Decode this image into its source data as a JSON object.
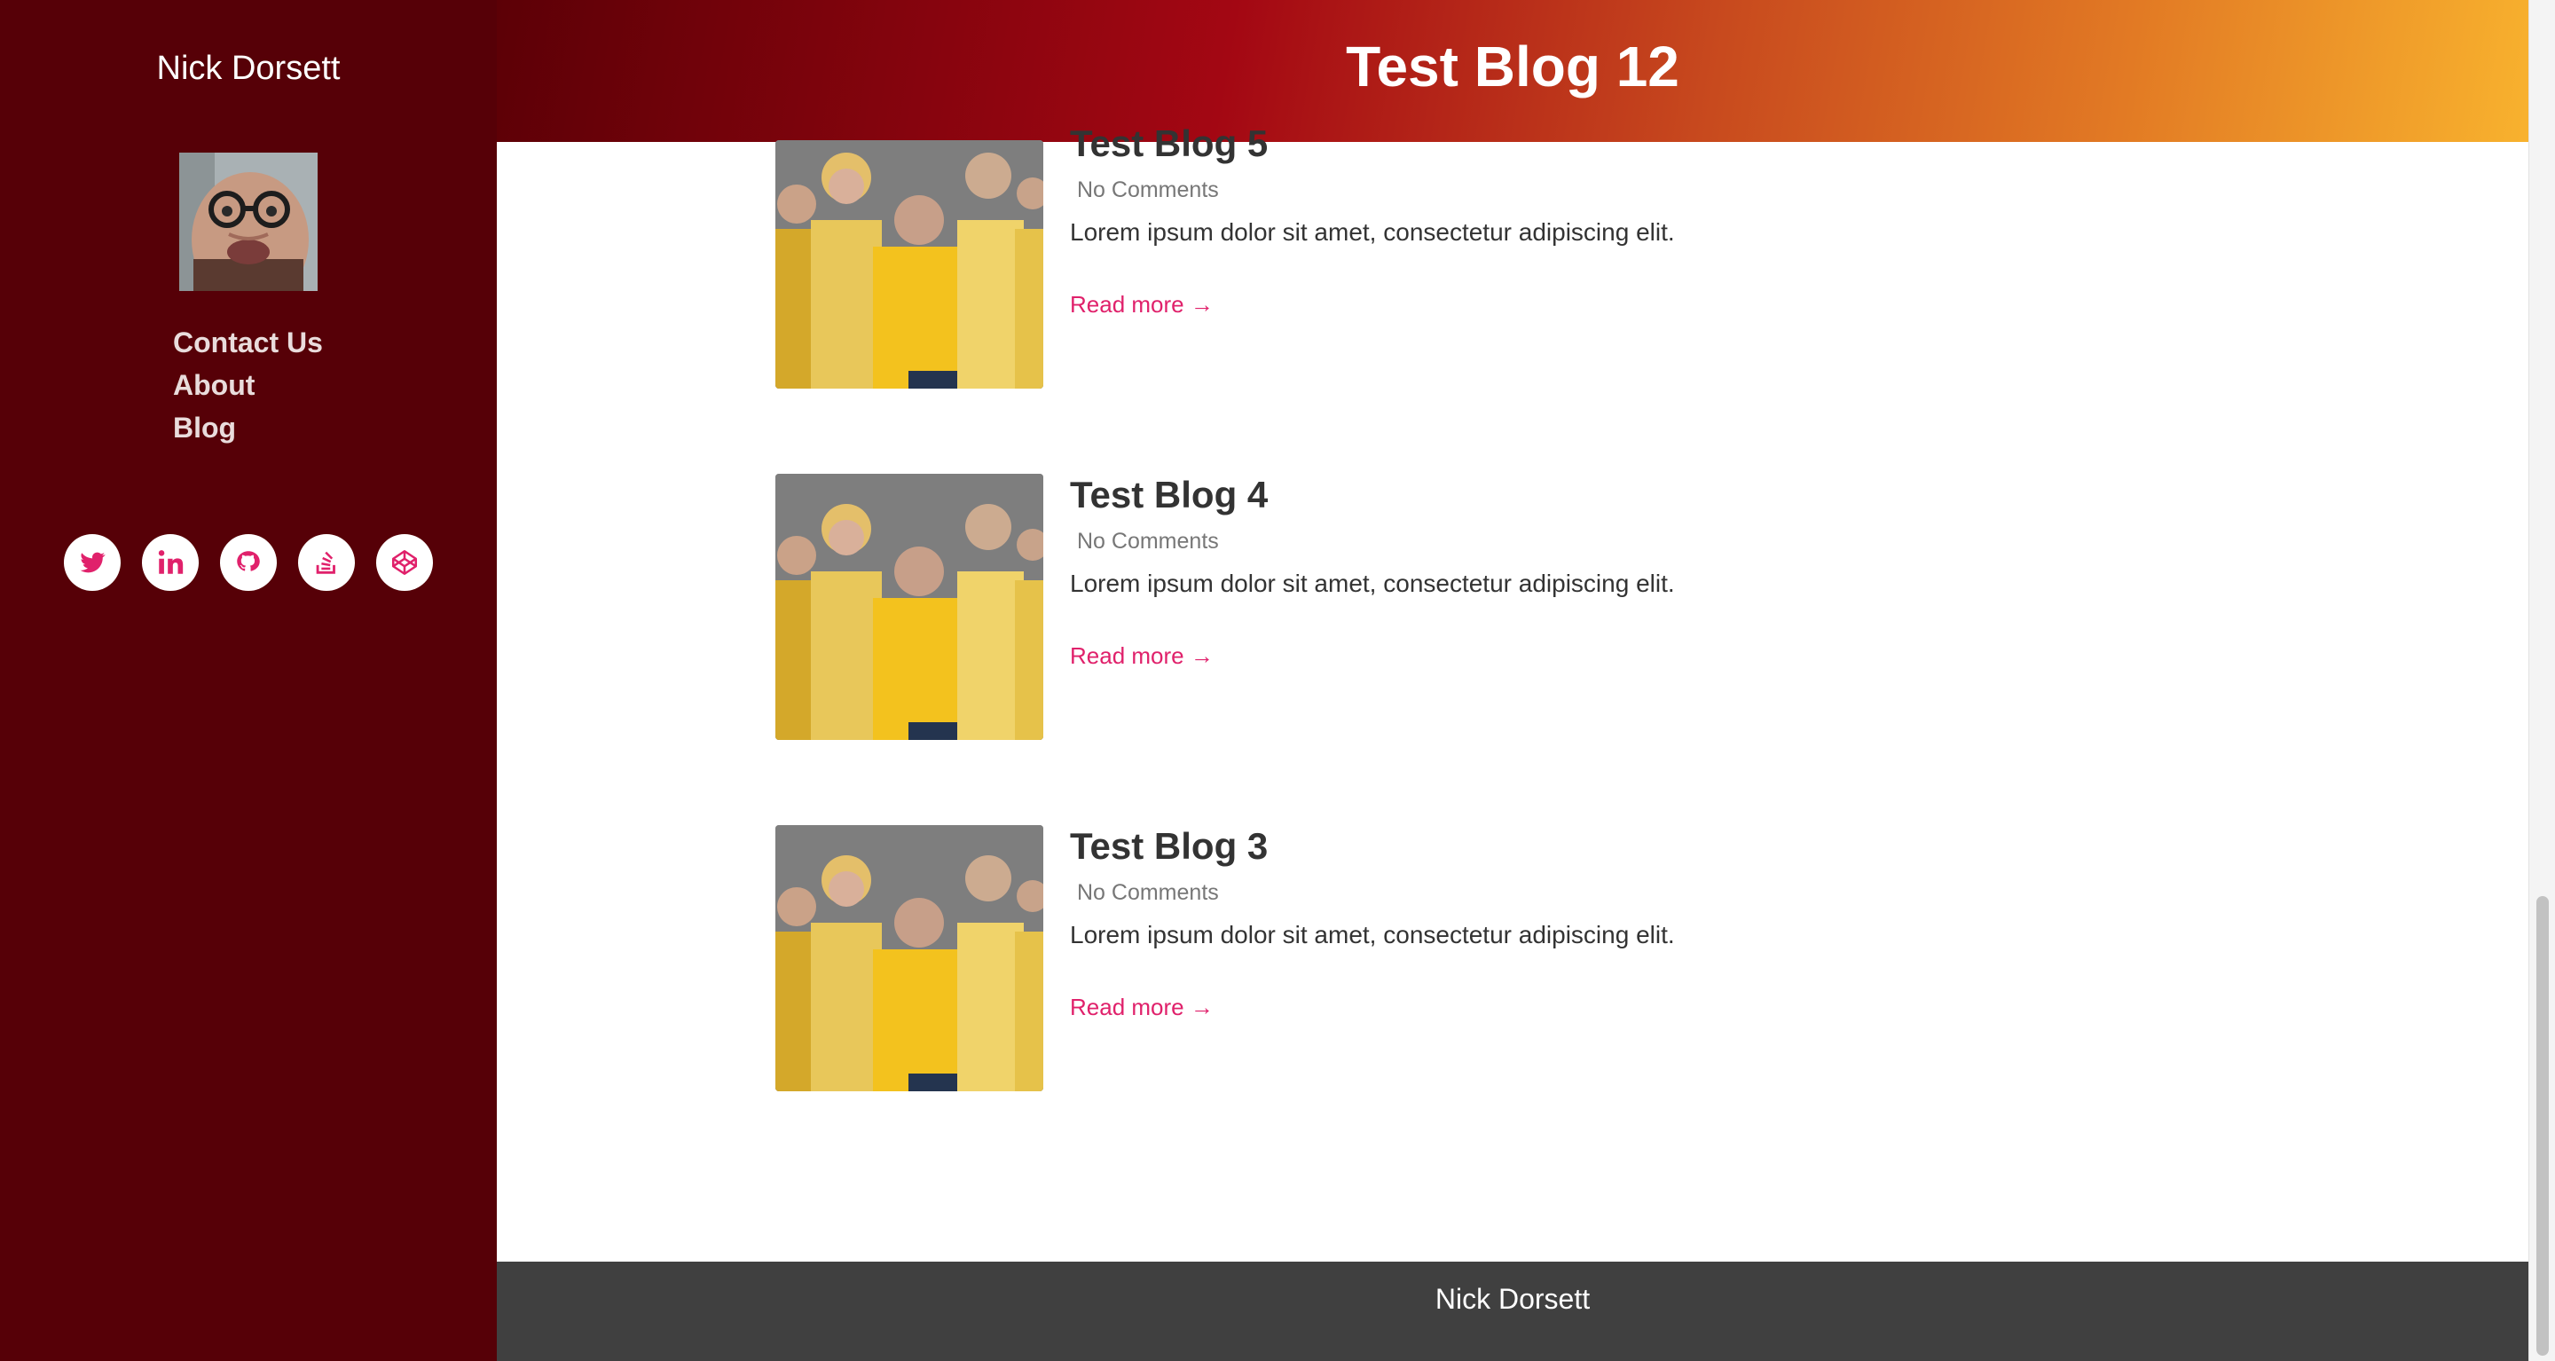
{
  "sidebar": {
    "name": "Nick Dorsett",
    "nav": [
      {
        "label": "Contact Us"
      },
      {
        "label": "About"
      },
      {
        "label": "Blog"
      }
    ],
    "socials": [
      {
        "icon": "twitter-icon"
      },
      {
        "icon": "linkedin-icon"
      },
      {
        "icon": "github-icon"
      },
      {
        "icon": "stackoverflow-icon"
      },
      {
        "icon": "codepen-icon"
      }
    ]
  },
  "header": {
    "title": "Test Blog 12"
  },
  "posts": [
    {
      "title": "Test Blog 5",
      "comments": "No Comments",
      "excerpt": "Lorem ipsum dolor sit amet, consectetur adipiscing elit.",
      "read_more": "Read more →"
    },
    {
      "title": "Test Blog 4",
      "comments": "No Comments",
      "excerpt": "Lorem ipsum dolor sit amet, consectetur adipiscing elit.",
      "read_more": "Read more →"
    },
    {
      "title": "Test Blog 3",
      "comments": "No Comments",
      "excerpt": "Lorem ipsum dolor sit amet, consectetur adipiscing elit.",
      "read_more": "Read more →"
    }
  ],
  "footer": {
    "text": "Nick Dorsett"
  },
  "colors": {
    "sidebar_bg": "#560007",
    "accent_link": "#e0216b",
    "footer_bg": "#404040",
    "header_gradient_start": "#5c0006",
    "header_gradient_end": "#f8b22e"
  }
}
